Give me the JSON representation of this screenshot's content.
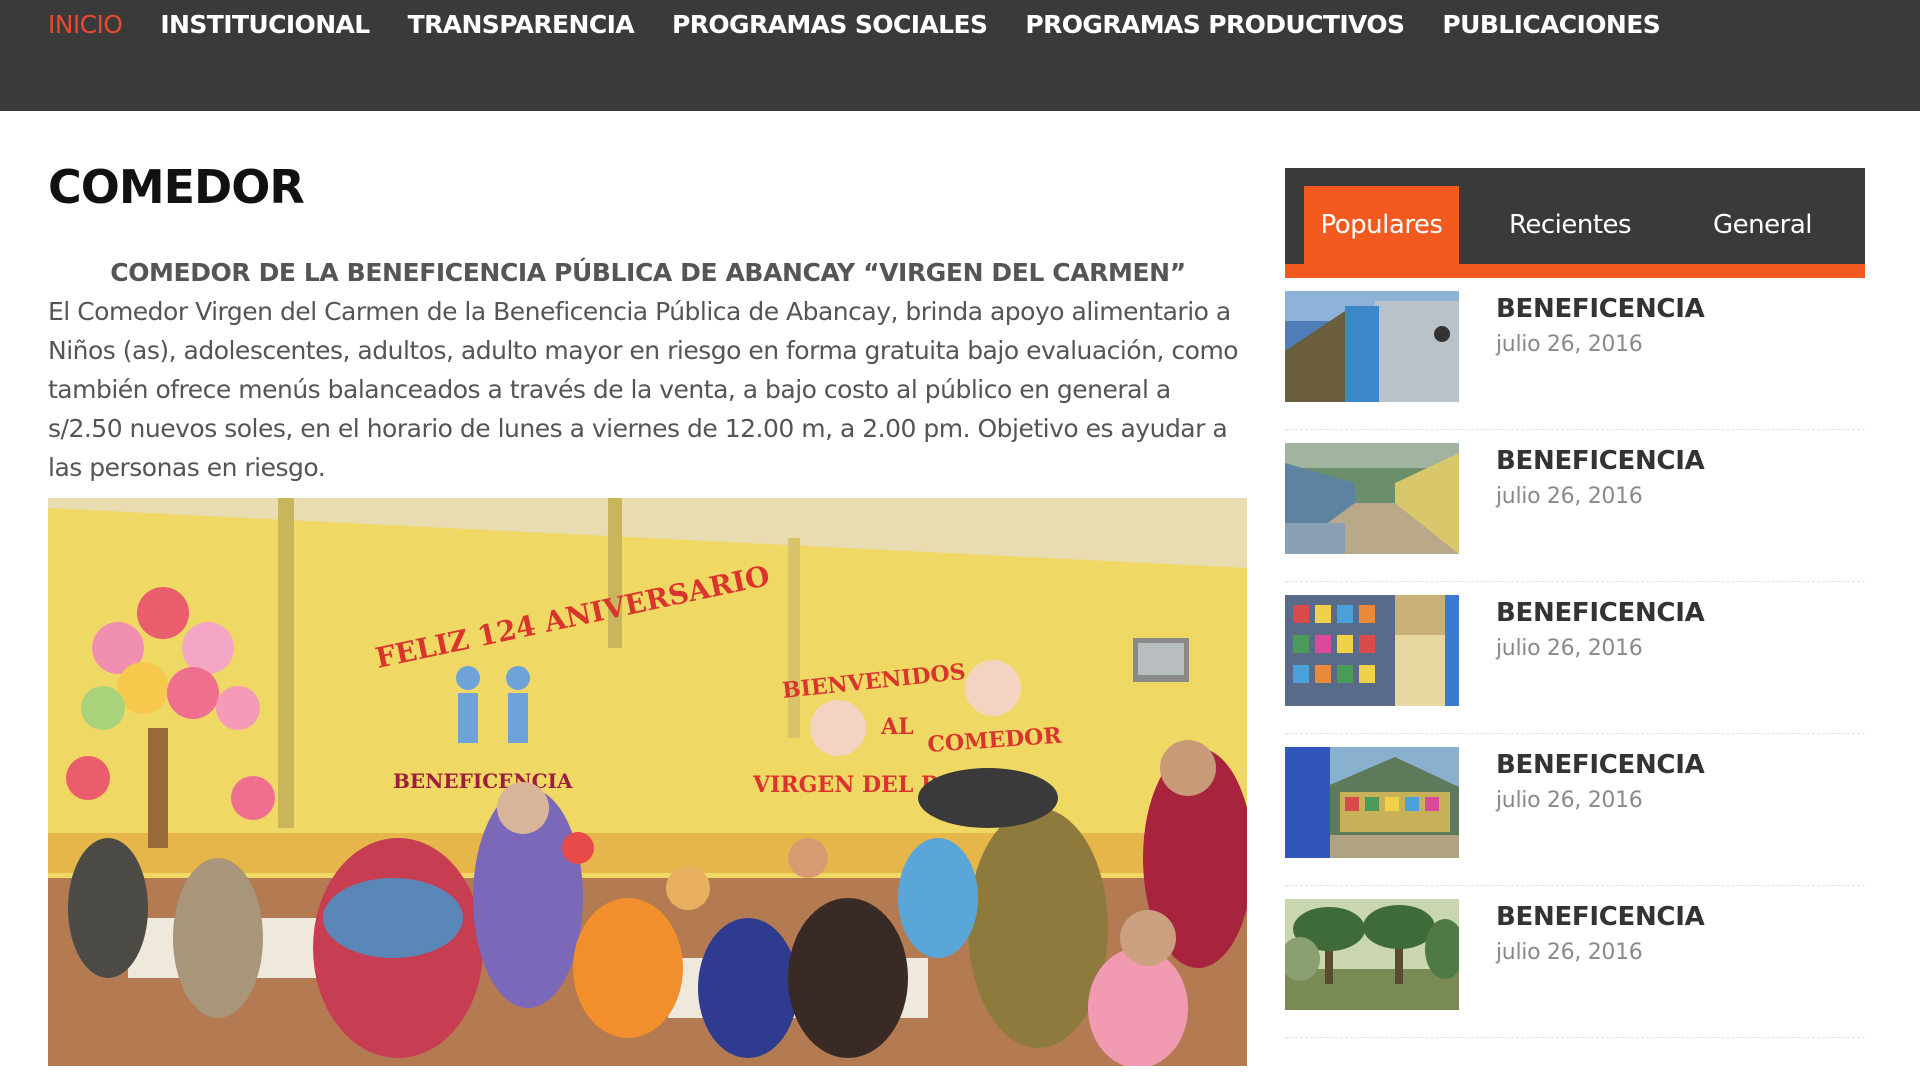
{
  "nav": {
    "items": [
      {
        "label": "INICIO",
        "active": true
      },
      {
        "label": "INSTITUCIONAL",
        "active": false
      },
      {
        "label": "TRANSPARENCIA",
        "active": false
      },
      {
        "label": "PROGRAMAS SOCIALES",
        "active": false
      },
      {
        "label": "PROGRAMAS PRODUCTIVOS",
        "active": false
      },
      {
        "label": "PUBLICACIONES",
        "active": false
      }
    ]
  },
  "article": {
    "title": "COMEDOR",
    "subheading": "COMEDOR DE LA BENEFICENCIA PÚBLICA DE ABANCAY “VIRGEN DEL CARMEN”",
    "body": "El Comedor Virgen del Carmen de la Beneficencia Pública de Abancay, brinda apoyo alimentario a Niños (as), adolescentes, adultos, adulto mayor en riesgo en forma gratuita bajo evaluación, como también ofrece menús balanceados a través de la venta, a bajo costo al público en general a s/2.50 nuevos soles, en el horario de lunes a viernes de 12.00 m, a 2.00 pm. Objetivo es ayudar a las personas en riesgo.",
    "photo_texts": {
      "wall_left": "FELIZ 124 ANIVERSARIO",
      "wall_left_2": "BENEFICENCIA",
      "wall_right_1": "BIENVENIDOS",
      "wall_right_2": "AL",
      "wall_right_3": "COMEDOR",
      "wall_right_4": "VIRGEN DEL ROSARIO"
    }
  },
  "sidebar": {
    "tabs": [
      {
        "label": "Populares",
        "active": true
      },
      {
        "label": "Recientes",
        "active": false
      },
      {
        "label": "General",
        "active": false
      }
    ],
    "posts": [
      {
        "title": "BENEFICENCIA",
        "date": "julio 26, 2016"
      },
      {
        "title": "BENEFICENCIA",
        "date": "julio 26, 2016"
      },
      {
        "title": "BENEFICENCIA",
        "date": "julio 26, 2016"
      },
      {
        "title": "BENEFICENCIA",
        "date": "julio 26, 2016"
      },
      {
        "title": "BENEFICENCIA",
        "date": "julio 26, 2016"
      }
    ]
  },
  "colors": {
    "nav_bg": "#3a3a3a",
    "accent": "#f25a1f",
    "nav_active": "#e8492a"
  }
}
